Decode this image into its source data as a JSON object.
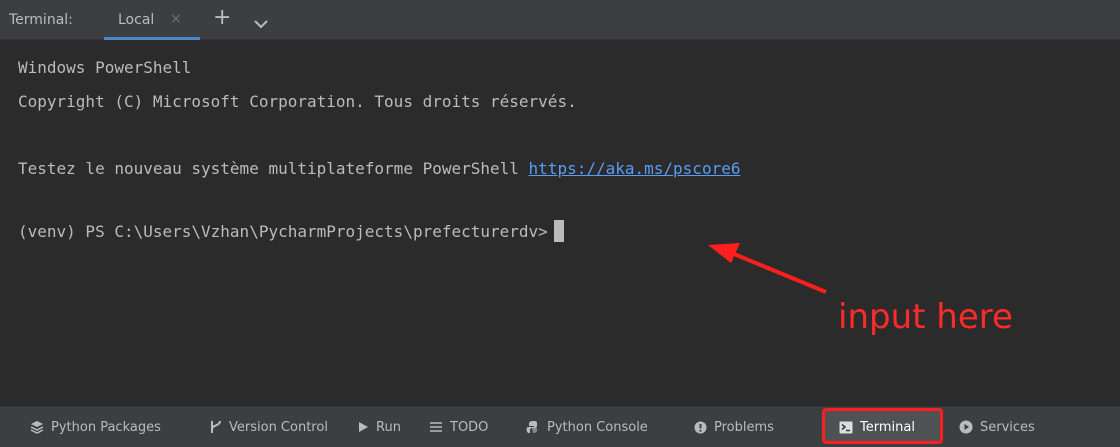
{
  "tabbar": {
    "title": "Terminal:",
    "tab_label": "Local",
    "close_glyph": "×",
    "add_glyph": "+"
  },
  "terminal": {
    "lines": [
      "Windows PowerShell",
      "Copyright (C) Microsoft Corporation. Tous droits réservés.",
      "",
      "Testez le nouveau système multiplateforme PowerShell ",
      "",
      "(venv) PS C:\\Users\\Vzhan\\PycharmProjects\\prefecturerdv>"
    ],
    "link": "https://aka.ms/pscore6"
  },
  "annotation": {
    "text": "input here",
    "color": "#ff2a2a"
  },
  "toolbar": {
    "items": [
      {
        "label": "Python Packages",
        "icon": "layers-icon"
      },
      {
        "label": "Version Control",
        "icon": "vcs-branch-icon"
      },
      {
        "label": "Run",
        "icon": "play-icon"
      },
      {
        "label": "TODO",
        "icon": "list-icon"
      },
      {
        "label": "Python Console",
        "icon": "python-icon"
      },
      {
        "label": "Problems",
        "icon": "warning-icon"
      },
      {
        "label": "Terminal",
        "icon": "terminal-icon",
        "active": true
      },
      {
        "label": "Services",
        "icon": "services-icon"
      }
    ]
  },
  "colors": {
    "background": "#2b2b2b",
    "chrome": "#3c3f41",
    "text": "#bbbbbb",
    "link": "#589df6",
    "accent": "#4a88c7",
    "highlight": "#ff1e1e"
  }
}
